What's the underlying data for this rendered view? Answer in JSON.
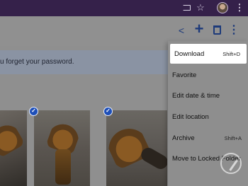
{
  "browser": {
    "icons": [
      "cast-icon",
      "star-icon",
      "avatar",
      "kebab-icon"
    ]
  },
  "toolbar": {
    "icons": [
      "share-icon",
      "add-icon",
      "trash-icon",
      "more-vert-icon"
    ]
  },
  "banner": {
    "text": "u forget your password."
  },
  "menu": {
    "items": [
      {
        "label": "Download",
        "shortcut": "Shift+D",
        "highlighted": true
      },
      {
        "label": "Favorite",
        "shortcut": ""
      },
      {
        "label": "Edit date & time",
        "shortcut": ""
      },
      {
        "label": "Edit location",
        "shortcut": ""
      },
      {
        "label": "Archive",
        "shortcut": "Shift+A"
      },
      {
        "label": "Move to Locked Folder",
        "shortcut": ""
      }
    ]
  },
  "photos": [
    {
      "selected": false
    },
    {
      "selected": true
    },
    {
      "selected": true
    }
  ],
  "colors": {
    "chrome": "#35214a",
    "accent": "#1e4fb8",
    "icon": "#1d3a7a"
  }
}
